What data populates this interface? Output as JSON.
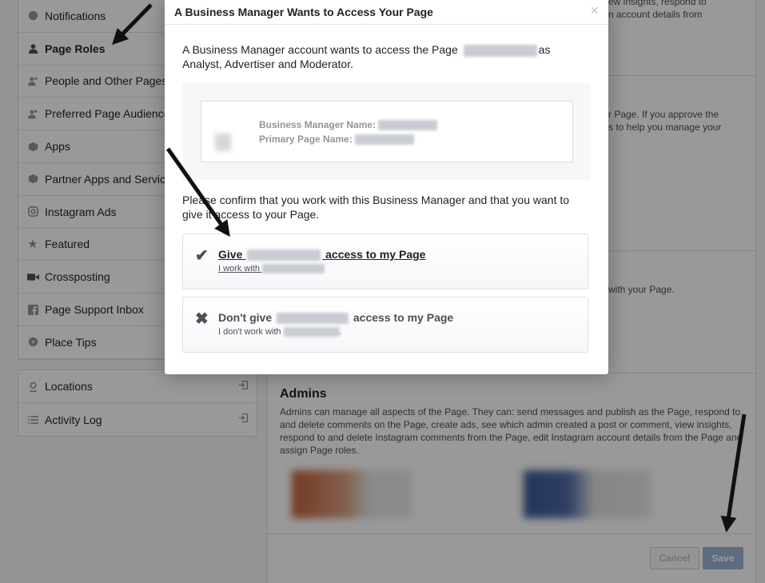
{
  "sidebar": {
    "items": [
      {
        "label": "Notifications",
        "icon": "globe-icon"
      },
      {
        "label": "Page Roles",
        "icon": "person-icon",
        "active": true
      },
      {
        "label": "People and Other Pages",
        "icon": "people-icon"
      },
      {
        "label": "Preferred Page Audience",
        "icon": "people-icon"
      },
      {
        "label": "Apps",
        "icon": "cube-icon"
      },
      {
        "label": "Partner Apps and Services",
        "icon": "cube-icon"
      },
      {
        "label": "Instagram Ads",
        "icon": "instagram-icon"
      },
      {
        "label": "Featured",
        "icon": "star-icon"
      },
      {
        "label": "Crossposting",
        "icon": "video-icon"
      },
      {
        "label": "Page Support Inbox",
        "icon": "facebook-icon"
      },
      {
        "label": "Place Tips",
        "icon": "compass-icon"
      }
    ],
    "secondary": [
      {
        "label": "Locations",
        "icon": "location-pin-icon"
      },
      {
        "label": "Activity Log",
        "icon": "list-icon"
      }
    ]
  },
  "main": {
    "fragments": {
      "f1": "ew insights, respond to",
      "f2": "n account details from",
      "f3": "r Page. If you approve the",
      "f4": "s to help you manage your",
      "f5": "with your Page."
    },
    "admins_title": "Admins",
    "admins_desc": "Admins can manage all aspects of the Page. They can: send messages and publish as the Page, respond to and delete comments on the Page, create ads, see which admin created a post or comment, view insights, respond to and delete Instagram comments from the Page, edit Instagram account details from the Page and assign Page roles.",
    "cancel_label": "Cancel",
    "save_label": "Save"
  },
  "dialog": {
    "title": "A Business Manager Wants to Access Your Page",
    "close_glyph": "×",
    "intro_a": "A Business Manager account wants to access the Page",
    "intro_b": "as Analyst, Advertiser and Moderator.",
    "bm_name_label": "Business Manager Name:",
    "primary_page_label": "Primary Page Name:",
    "confirm_text": "Please confirm that you work with this Business Manager and that you want to give it access to your Page.",
    "give": {
      "mark": "✔",
      "pre": "Give",
      "post": "access to my Page",
      "sub": "I work with"
    },
    "dont": {
      "mark": "✖",
      "pre": "Don't give",
      "post": "access to my Page",
      "sub_pre": "I don't work with",
      "sub_post": "."
    }
  },
  "colors": {
    "overlay": "#000000",
    "save_bg": "#9cb4d8",
    "border": "#dddfe2"
  }
}
